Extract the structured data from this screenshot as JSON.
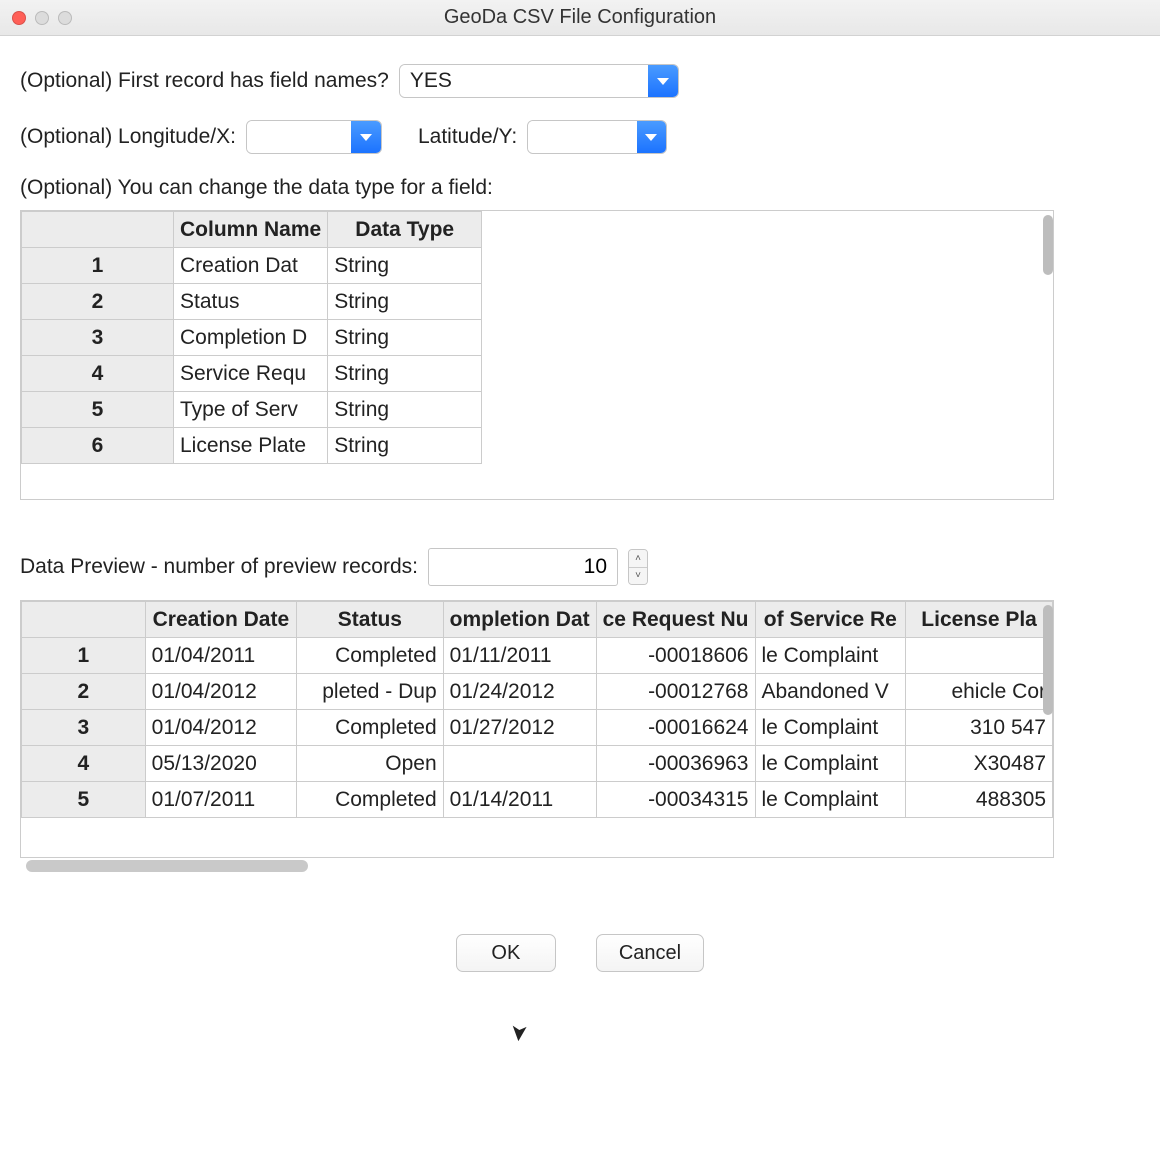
{
  "window": {
    "title": "GeoDa CSV File Configuration"
  },
  "row1": {
    "label": "(Optional) First record has field names?",
    "value": "YES"
  },
  "row2": {
    "lon_label": "(Optional) Longitude/X:",
    "lon_value": "",
    "lat_label": "Latitude/Y:",
    "lat_value": ""
  },
  "row3": {
    "label": "(Optional) You can change the data type for a field:"
  },
  "type_table": {
    "headers": {
      "blank": "",
      "col1": "Column Name",
      "col2": "Data Type"
    },
    "rows": [
      {
        "n": "1",
        "name": "Creation Dat",
        "type": "String"
      },
      {
        "n": "2",
        "name": "Status",
        "type": "String"
      },
      {
        "n": "3",
        "name": "Completion D",
        "type": "String"
      },
      {
        "n": "4",
        "name": "Service Requ",
        "type": "String"
      },
      {
        "n": "5",
        "name": "Type of Serv",
        "type": "String"
      },
      {
        "n": "6",
        "name": "License Plate",
        "type": "String"
      }
    ]
  },
  "preview": {
    "label": "Data Preview - number of preview records:",
    "count": "10",
    "headers": {
      "blank": "",
      "c1": "Creation Date",
      "c2": "Status",
      "c3": "ompletion Dat",
      "c4": "ce Request Nu",
      "c5": "of Service Re",
      "c6": "License Pla"
    },
    "rows": [
      {
        "n": "1",
        "c1": "01/04/2011",
        "c2": "Completed",
        "c3": "01/11/2011",
        "c4": "-00018606",
        "c5": "le Complaint",
        "c6": ""
      },
      {
        "n": "2",
        "c1": "01/04/2012",
        "c2": "pleted - Dup",
        "c3": "01/24/2012",
        "c4": "-00012768",
        "c5": "Abandoned V",
        "c6": "ehicle Cor"
      },
      {
        "n": "3",
        "c1": "01/04/2012",
        "c2": "Completed",
        "c3": "01/27/2012",
        "c4": "-00016624",
        "c5": "le Complaint",
        "c6": "310 547"
      },
      {
        "n": "4",
        "c1": "05/13/2020",
        "c2": "Open",
        "c3": "",
        "c4": "-00036963",
        "c5": "le Complaint",
        "c6": "X30487"
      },
      {
        "n": "5",
        "c1": "01/07/2011",
        "c2": "Completed",
        "c3": "01/14/2011",
        "c4": "-00034315",
        "c5": "le Complaint",
        "c6": "488305"
      }
    ]
  },
  "buttons": {
    "ok": "OK",
    "cancel": "Cancel"
  }
}
